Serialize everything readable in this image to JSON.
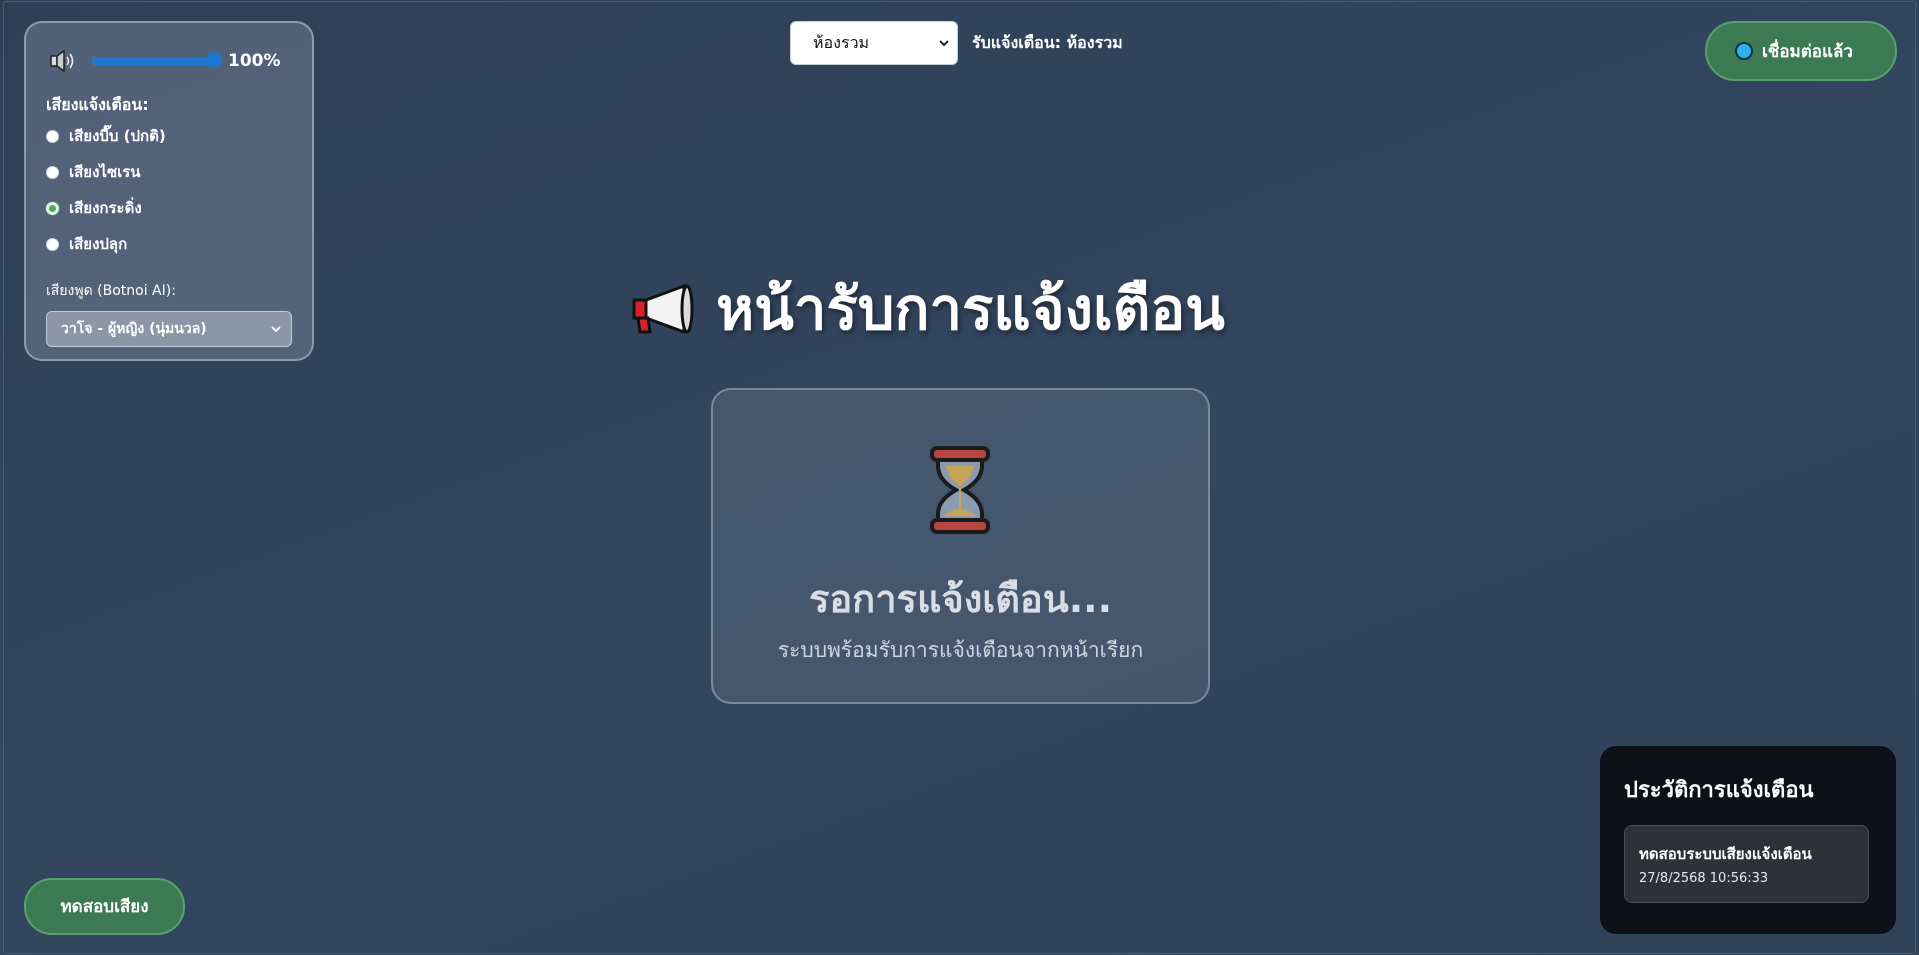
{
  "controls": {
    "volume_value": "100%",
    "volume_level": 1.0,
    "alert_sound_title": "เสียงแจ้งเตือน:",
    "alert_sounds": [
      {
        "label": "เสียงบี๊บ (ปกติ)",
        "checked": false
      },
      {
        "label": "เสียงไซเรน",
        "checked": false
      },
      {
        "label": "เสียงกระดิ่ง",
        "checked": true
      },
      {
        "label": "เสียงปลุก",
        "checked": false
      }
    ],
    "voice_label": "เสียงพูด (Botnoi AI):",
    "voice_selected": "วาโจ - ผู้หญิง (นุ่มนวล)"
  },
  "header": {
    "room_selected": "ห้องรวม",
    "room_status": "รับแจ้งเตือน: ห้องรวม",
    "connection_status": "เชื่อมต่อแล้ว"
  },
  "main": {
    "title": "หน้ารับการแจ้งเตือน",
    "waiting_title": "รอการแจ้งเตือน...",
    "waiting_subtitle": "ระบบพร้อมรับการแจ้งเตือนจากหน้าเรียก"
  },
  "test_button_label": "ทดสอบเสียง",
  "history": {
    "title": "ประวัติการแจ้งเตือน",
    "items": [
      {
        "title": "ทดสอบระบบเสียงแจ้งเตือน",
        "time": "27/8/2568 10:56:33"
      }
    ]
  },
  "icons": {
    "speaker": "speaker-icon",
    "megaphone": "megaphone-icon",
    "hourglass": "hourglass-icon",
    "status_dot": "connection-dot-icon"
  },
  "colors": {
    "accent_green": "#3c7a54",
    "slider_blue": "#1d77d2",
    "status_dot": "#2ab4ea"
  }
}
